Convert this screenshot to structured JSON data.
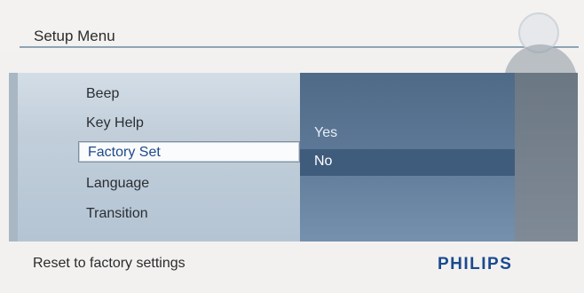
{
  "header": {
    "title": "Setup Menu"
  },
  "menu": {
    "items": [
      {
        "label": "Beep"
      },
      {
        "label": "Key Help"
      },
      {
        "label": "Factory Set"
      },
      {
        "label": "Language"
      },
      {
        "label": "Transition"
      }
    ],
    "selected": "Factory Set"
  },
  "submenu": {
    "options": [
      {
        "label": "Yes"
      },
      {
        "label": "No"
      }
    ],
    "selected": "No"
  },
  "footer": {
    "hint": "Reset to factory settings",
    "brand": "PHILIPS"
  },
  "colors": {
    "accent": "#1b4a8d",
    "panel_mid": "#5d7896",
    "selected_text": "#1e4a8a"
  },
  "icons": [
    "setup-icon",
    "navigation-pad-icon",
    "back-icon"
  ]
}
